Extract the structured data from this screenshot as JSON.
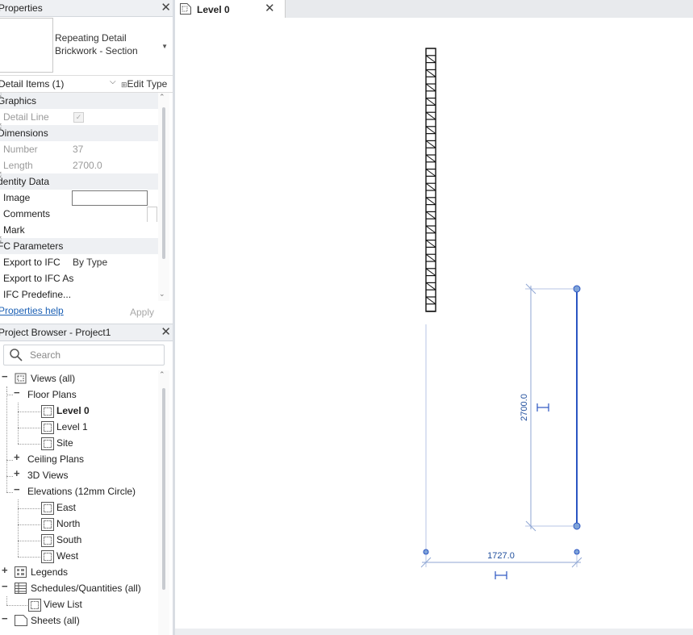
{
  "properties": {
    "title": "Properties",
    "type_name_line1": "Repeating Detail",
    "type_name_line2": "Brickwork - Section",
    "filter_label": "Detail Items (1)",
    "edit_type_label": "Edit Type",
    "groups": {
      "graphics": "Graphics",
      "dimensions": "Dimensions",
      "identity": "dentity Data",
      "ifc": "FC Parameters"
    },
    "rows": {
      "detail_line": "Detail Line",
      "number_label": "Number",
      "number_value": "37",
      "length_label": "Length",
      "length_value": "2700.0",
      "image_label": "Image",
      "comments_label": "Comments",
      "mark_label": "Mark",
      "export_ifc_label": "Export to IFC",
      "export_ifc_value": "By Type",
      "export_ifc_as_label": "Export to IFC As",
      "ifc_predefined_label": "IFC Predefine..."
    },
    "help_link": "Properties help",
    "apply_label": "Apply"
  },
  "browser": {
    "title": "Project Browser - Project1",
    "search_placeholder": "Search",
    "views_all": "Views (all)",
    "floor_plans": "Floor Plans",
    "level0": "Level 0",
    "level1": "Level 1",
    "site": "Site",
    "ceiling_plans": "Ceiling Plans",
    "views_3d": "3D Views",
    "elevations": "Elevations (12mm Circle)",
    "east": "East",
    "north": "North",
    "south": "South",
    "west": "West",
    "legends": "Legends",
    "schedules": "Schedules/Quantities (all)",
    "view_list": "View List",
    "sheets": "Sheets (all)"
  },
  "view": {
    "tab_label": "Level 0",
    "dim_vertical": "2700.0",
    "dim_horizontal": "1727.0"
  },
  "colors": {
    "dimension_blue": "#1f4e9c",
    "selected_line": "#2a55c2",
    "link_blue": "#1a5fb4"
  }
}
